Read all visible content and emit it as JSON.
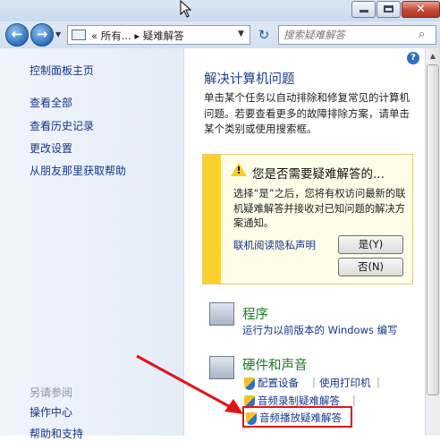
{
  "window": {
    "controls": {
      "minimize": "minimize",
      "maximize": "maximize",
      "close": "✕"
    }
  },
  "nav": {
    "back_icon": "arrow-left-icon",
    "forward_icon": "arrow-right-icon",
    "address": "«  所有...  ▸  疑难解答",
    "search_placeholder": "搜索疑难解答"
  },
  "left_pane": {
    "links": [
      "控制面板主页",
      "查看全部",
      "查看历史记录",
      "更改设置",
      "从朋友那里获取帮助"
    ],
    "see_also_title": "另请参阅",
    "see_also_links": [
      "操作中心",
      "帮助和支持"
    ]
  },
  "main": {
    "help": "?",
    "title": "解决计算机问题",
    "description": "单击某个任务以自动排除和修复常见的计算机问题。若要查看更多的故障排除方案，请单击某个类别或使用搜索框。",
    "notice": {
      "title": "您是否需要疑难解答的...",
      "body": "选择“是”之后，您将有权访问最新的联机疑难解答并接收对已知问题的解决方案通知。",
      "privacy_link": "联机阅读隐私声明",
      "yes_label": "是(Y)",
      "no_label": "否(N)"
    },
    "categories": [
      {
        "title": "程序",
        "links": [
          "运行为以前版本的 Windows 编写"
        ]
      },
      {
        "title": "硬件和声音",
        "links": [
          "配置设备",
          "使用打印机",
          "音频录制疑难解答",
          "音频播放疑难解答"
        ]
      }
    ]
  },
  "colors": {
    "link": "#15348a",
    "category_title": "#1c7a22",
    "highlight": "#e2121a",
    "notice_bar": "#fbd02b"
  }
}
